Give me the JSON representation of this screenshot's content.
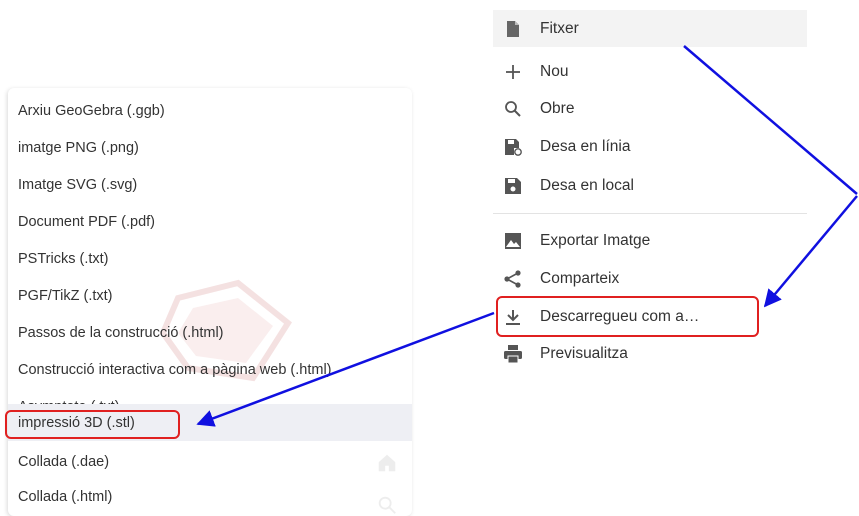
{
  "export_menu": {
    "items": [
      "Arxiu GeoGebra (.ggb)",
      "imatge PNG (.png)",
      "Imatge SVG (.svg)",
      "Document PDF (.pdf)",
      "PSTricks (.txt)",
      "PGF/TikZ (.txt)",
      "Passos de la construcció (.html)",
      "Construcció interactiva com a pàgina web (.html)",
      "Asymptote (.txt)",
      "impressió 3D (.stl)",
      "Collada (.dae)",
      "Collada (.html)"
    ],
    "highlighted_item": "impressió 3D (.stl)"
  },
  "file_menu": {
    "header": {
      "label": "Fitxer",
      "icon": "file-icon"
    },
    "items": [
      {
        "label": "Nou",
        "icon": "plus-icon"
      },
      {
        "label": "Obre",
        "icon": "search-icon"
      },
      {
        "label": "Desa en línia",
        "icon": "save-online-icon"
      },
      {
        "label": "Desa en local",
        "icon": "save-icon"
      },
      {
        "label": "Exportar Imatge",
        "icon": "image-icon"
      },
      {
        "label": "Comparteix",
        "icon": "share-icon"
      },
      {
        "label": "Descarregueu com a…",
        "icon": "download-icon"
      },
      {
        "label": "Previsualitza",
        "icon": "print-icon"
      }
    ]
  },
  "annotations": {
    "highlight_color": "#e02020",
    "arrow_color": "#1010e0"
  }
}
